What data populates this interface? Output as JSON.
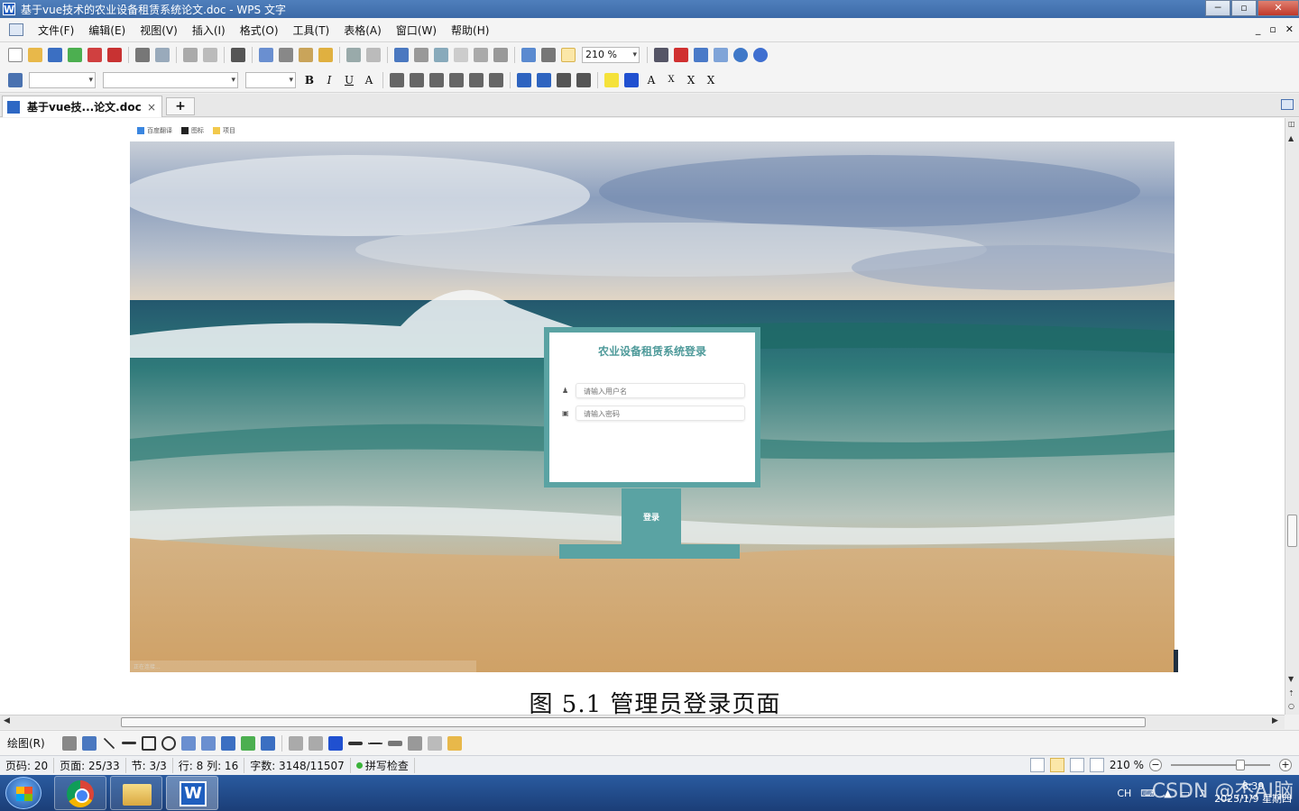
{
  "window": {
    "title": "基于vue技术的农业设备租赁系统论文.doc - WPS 文字",
    "app_icon": "W"
  },
  "menu": {
    "items": [
      "文件(F)",
      "编辑(E)",
      "视图(V)",
      "插入(I)",
      "格式(O)",
      "工具(T)",
      "表格(A)",
      "窗口(W)",
      "帮助(H)"
    ]
  },
  "toolbar": {
    "zoom_value": "210 %",
    "format_buttons": [
      "B",
      "I",
      "U",
      "A",
      "A",
      "X",
      "X"
    ]
  },
  "tabs": {
    "doc_tab_label": "基于vue技...论文.doc",
    "close_glyph": "×",
    "new_tab_glyph": "+"
  },
  "document": {
    "bookmarks": [
      "百度翻译",
      "图标",
      "项目"
    ],
    "login": {
      "title": "农业设备租赁系统登录",
      "username_placeholder": "请输入用户名",
      "password_placeholder": "请输入密码",
      "login_button": "登录",
      "status_hint": "正在连接..."
    },
    "caption": "图 5.1  管理员登录页面"
  },
  "drawing_toolbar": {
    "label": "绘图(R)"
  },
  "statusbar": {
    "page_code": "页码: 20",
    "pages": "页面: 25/33",
    "section": "节: 3/3",
    "line_col": "行: 8  列: 16",
    "word_count": "字数: 3148/11507",
    "spell_check": "拼写检查",
    "zoom": "210 %",
    "zoom_minus": "−",
    "zoom_plus": "+"
  },
  "taskbar": {
    "ime": "CH",
    "time": "8:39",
    "date": "2025/1/9 星期四"
  },
  "watermark": "CSDN @杰AI脑",
  "colors": {
    "accent_teal": "#5aa3a3",
    "title_bar": "#3c6aa7"
  }
}
